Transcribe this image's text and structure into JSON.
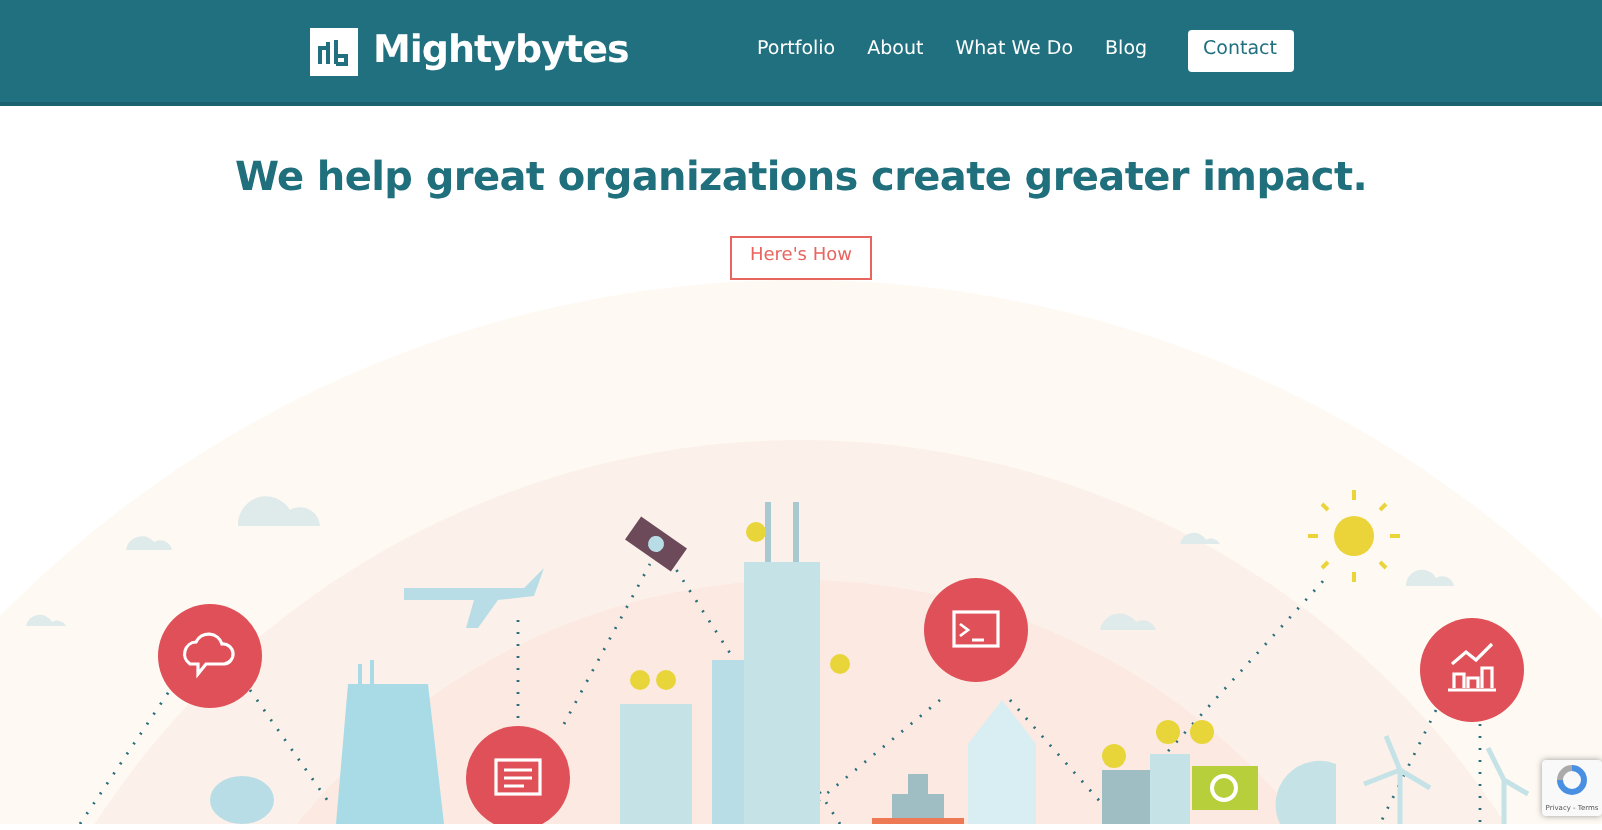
{
  "navbar": {
    "brand": "Mightybytes",
    "links": [
      "Portfolio",
      "About",
      "What We Do",
      "Blog"
    ],
    "contact_button": "Contact"
  },
  "hero": {
    "headline": "We help great organizations create greater impact.",
    "cta_button": "Here's How"
  },
  "recaptcha_badge": {
    "text": "Privacy - Terms"
  }
}
